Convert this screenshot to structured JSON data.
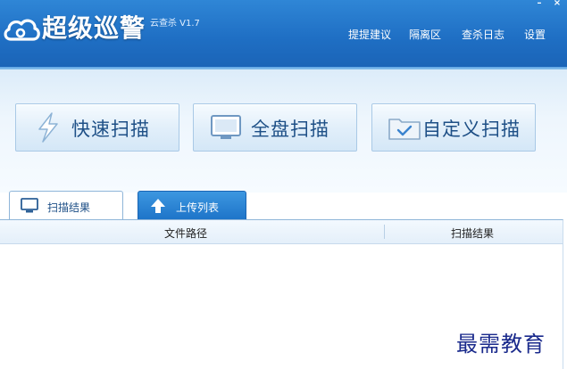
{
  "header": {
    "title": "超级巡警",
    "subtitle": "云查杀 V1.7",
    "nav": [
      "提提建议",
      "隔离区",
      "查杀日志",
      "设置"
    ],
    "window_controls": {
      "minimize": "–",
      "close": "×"
    },
    "colors": {
      "bar": "#1f6fc4",
      "accent": "#1d4f86"
    }
  },
  "scan_buttons": [
    {
      "label": "快速扫描",
      "icon": "lightning-icon"
    },
    {
      "label": "全盘扫描",
      "icon": "monitor-icon"
    },
    {
      "label": "自定义扫描",
      "icon": "folder-check-icon"
    }
  ],
  "tabs": [
    {
      "label": "扫描结果",
      "icon": "monitor-icon",
      "active": false
    },
    {
      "label": "上传列表",
      "icon": "upload-arrow-icon",
      "active": true
    }
  ],
  "table": {
    "columns": [
      "文件路径",
      "扫描结果"
    ],
    "rows": []
  },
  "watermark": "最需教育"
}
